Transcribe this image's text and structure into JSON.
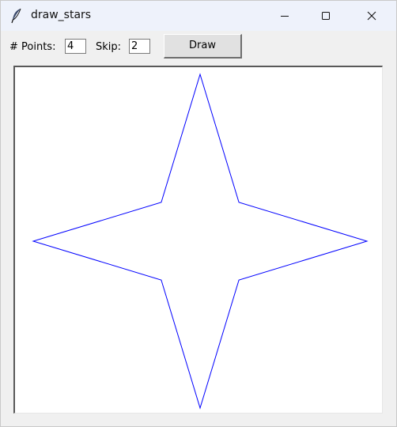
{
  "window": {
    "title": "draw_stars",
    "icon": "feather-icon",
    "controls": [
      "minimize-icon",
      "maximize-icon",
      "close-icon"
    ]
  },
  "controls": {
    "points_label": "# Points:",
    "points_value": "4",
    "skip_label": "Skip:",
    "skip_value": "2",
    "draw_label": "Draw"
  },
  "canvas": {
    "background": "#ffffff",
    "star": {
      "points": 4,
      "skip": 2,
      "stroke_color": "#0000ff"
    }
  }
}
